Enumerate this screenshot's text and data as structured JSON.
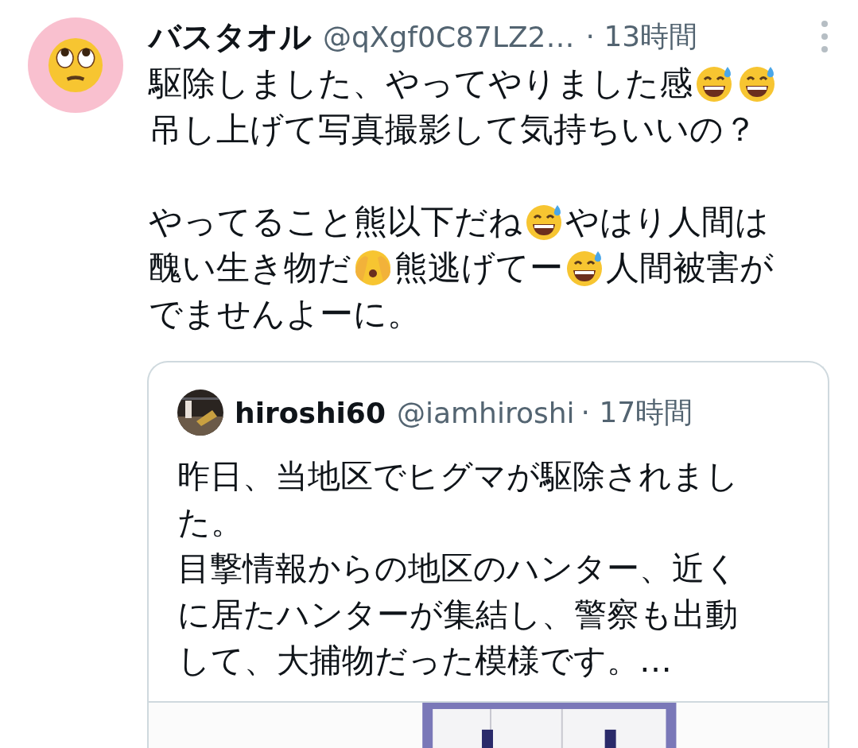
{
  "tweet": {
    "name": "バスタオル",
    "handle": "@qXgf0C87LZ2…",
    "time": "· 13時間",
    "paragraphs": [
      [
        [
          {
            "kind": "text",
            "text": "駆除しました、やってやりました感"
          },
          {
            "kind": "sweat"
          },
          {
            "kind": "sweat"
          }
        ],
        [
          {
            "kind": "text",
            "text": "吊し上げて写真撮影して気持ちいいの？"
          }
        ]
      ],
      [
        [
          {
            "kind": "text",
            "text": "やってること熊以下だね"
          },
          {
            "kind": "sweat"
          },
          {
            "kind": "text",
            "text": "やはり人間は"
          }
        ],
        [
          {
            "kind": "text",
            "text": "醜い生き物だ"
          },
          {
            "kind": "peek"
          },
          {
            "kind": "text",
            "text": "熊逃げてー"
          },
          {
            "kind": "sweat"
          },
          {
            "kind": "text",
            "text": "人間被害が"
          }
        ],
        [
          {
            "kind": "text",
            "text": "でませんよーに。"
          }
        ]
      ]
    ]
  },
  "quote": {
    "name": "hiroshi60",
    "handle": "@iamhiroshi",
    "time": "· 17時間",
    "lines": [
      "昨日、当地区でヒグマが駆除されまし",
      "た。",
      "目撃情報からの地区のハンター、近く",
      "に居たハンターが集結し、警察も出動",
      "して、大捕物だった模様です。…"
    ]
  }
}
